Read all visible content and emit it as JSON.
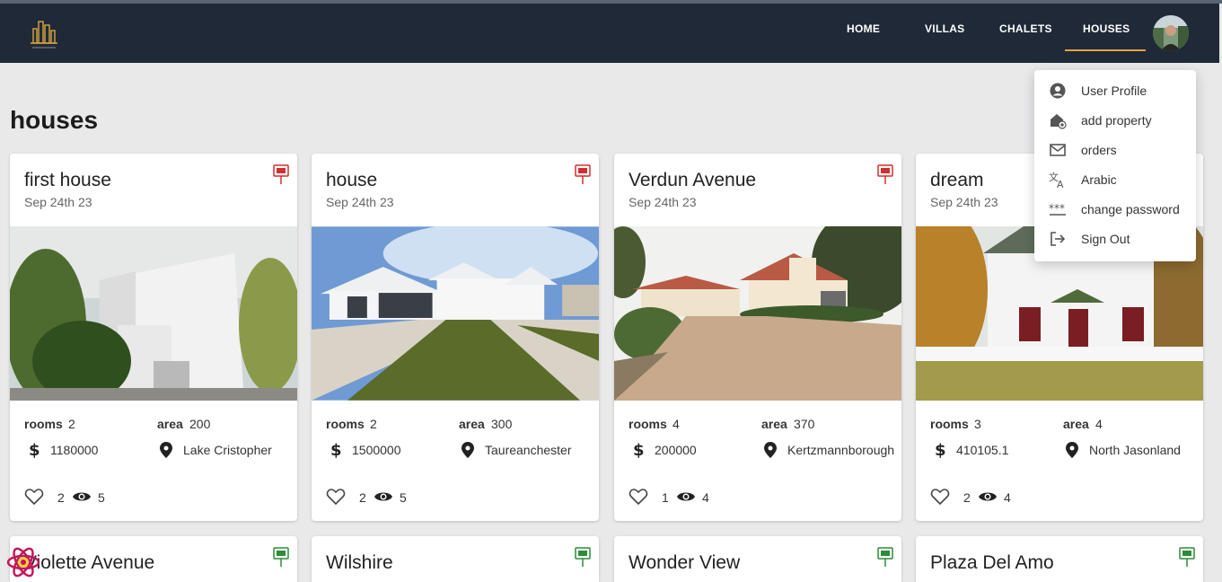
{
  "nav": {
    "links": [
      {
        "label": "HOME"
      },
      {
        "label": "VILLAS"
      },
      {
        "label": "CHALETS"
      },
      {
        "label": "HOUSES",
        "active": true
      }
    ],
    "accent_color": "#e3a33a",
    "background": "#1f2937"
  },
  "page": {
    "title": "houses"
  },
  "cards": [
    {
      "title": "first house",
      "date": "Sep 24th 23",
      "status_icon": "for-sale-sign-icon",
      "rooms_label": "rooms",
      "rooms": "2",
      "area_label": "area",
      "area": "200",
      "price": "1180000",
      "location": "Lake Cristopher",
      "likes": "2",
      "views": "5"
    },
    {
      "title": "house",
      "date": "Sep 24th 23",
      "status_icon": "for-sale-sign-icon",
      "rooms_label": "rooms",
      "rooms": "2",
      "area_label": "area",
      "area": "300",
      "price": "1500000",
      "location": "Taureanchester",
      "likes": "2",
      "views": "5"
    },
    {
      "title": "Verdun Avenue",
      "date": "Sep 24th 23",
      "status_icon": "for-sale-sign-icon",
      "rooms_label": "rooms",
      "rooms": "4",
      "area_label": "area",
      "area": "370",
      "price": "200000",
      "location": "Kertzmannborough",
      "likes": "1",
      "views": "4"
    },
    {
      "title": "dream",
      "date": "Sep 24th 23",
      "status_icon": "for-sale-sign-icon",
      "rooms_label": "rooms",
      "rooms": "3",
      "area_label": "area",
      "area": "4",
      "price": "410105.1",
      "location": "North Jasonland",
      "likes": "2",
      "views": "4"
    }
  ],
  "cards_row2": [
    {
      "title": "Violette Avenue",
      "status_icon": "for-rent-sign-icon"
    },
    {
      "title": "Wilshire",
      "status_icon": "for-rent-sign-icon"
    },
    {
      "title": "Wonder View",
      "status_icon": "for-rent-sign-icon"
    },
    {
      "title": "Plaza Del Amo",
      "status_icon": "for-rent-sign-icon"
    }
  ],
  "user_menu": {
    "items": [
      {
        "label": "User Profile",
        "icon": "account-circle-icon"
      },
      {
        "label": "add property",
        "icon": "add-home-icon"
      },
      {
        "label": "orders",
        "icon": "mail-icon"
      },
      {
        "label": "Arabic",
        "icon": "translate-icon"
      },
      {
        "label": "change password",
        "icon": "password-icon"
      },
      {
        "label": "Sign Out",
        "icon": "logout-icon"
      }
    ]
  }
}
